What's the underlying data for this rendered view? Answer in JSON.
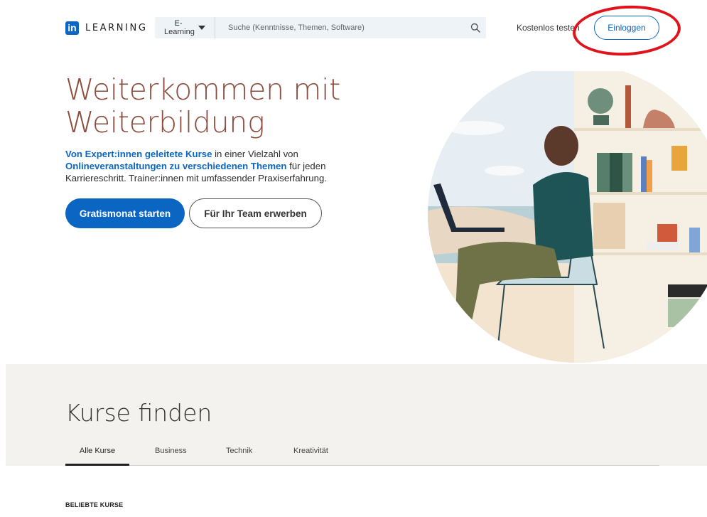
{
  "header": {
    "logo_text": "LEARNING",
    "logo_in": "in",
    "category_select": "E-Learning",
    "search_placeholder": "Suche (Kenntnisse, Themen, Software)",
    "trial_link": "Kostenlos testen",
    "login_button": "Einloggen"
  },
  "hero": {
    "title": "Weiterkommen mit Weiterbildung",
    "body_link_1": "Von Expert:innen geleitete Kurse",
    "body_text_1": " in einer Vielzahl von ",
    "body_link_2": "Onlineveranstaltungen zu verschiedenen Themen",
    "body_text_2": " für jeden Karriereschritt. Trainer:innen mit umfassender Praxiserfahrung.",
    "primary_button": "Gratismonat starten",
    "secondary_button": "Für Ihr Team erwerben"
  },
  "find_courses": {
    "title": "Kurse finden",
    "tabs": [
      {
        "label": "Alle Kurse",
        "active": true
      },
      {
        "label": "Business",
        "active": false
      },
      {
        "label": "Technik",
        "active": false
      },
      {
        "label": "Kreativität",
        "active": false
      }
    ],
    "popular_label": "BELIEBTE KURSE"
  },
  "colors": {
    "brand_blue": "#0a66c2",
    "title_brown": "#8b4d3e",
    "annotation_red": "#e0121b"
  }
}
